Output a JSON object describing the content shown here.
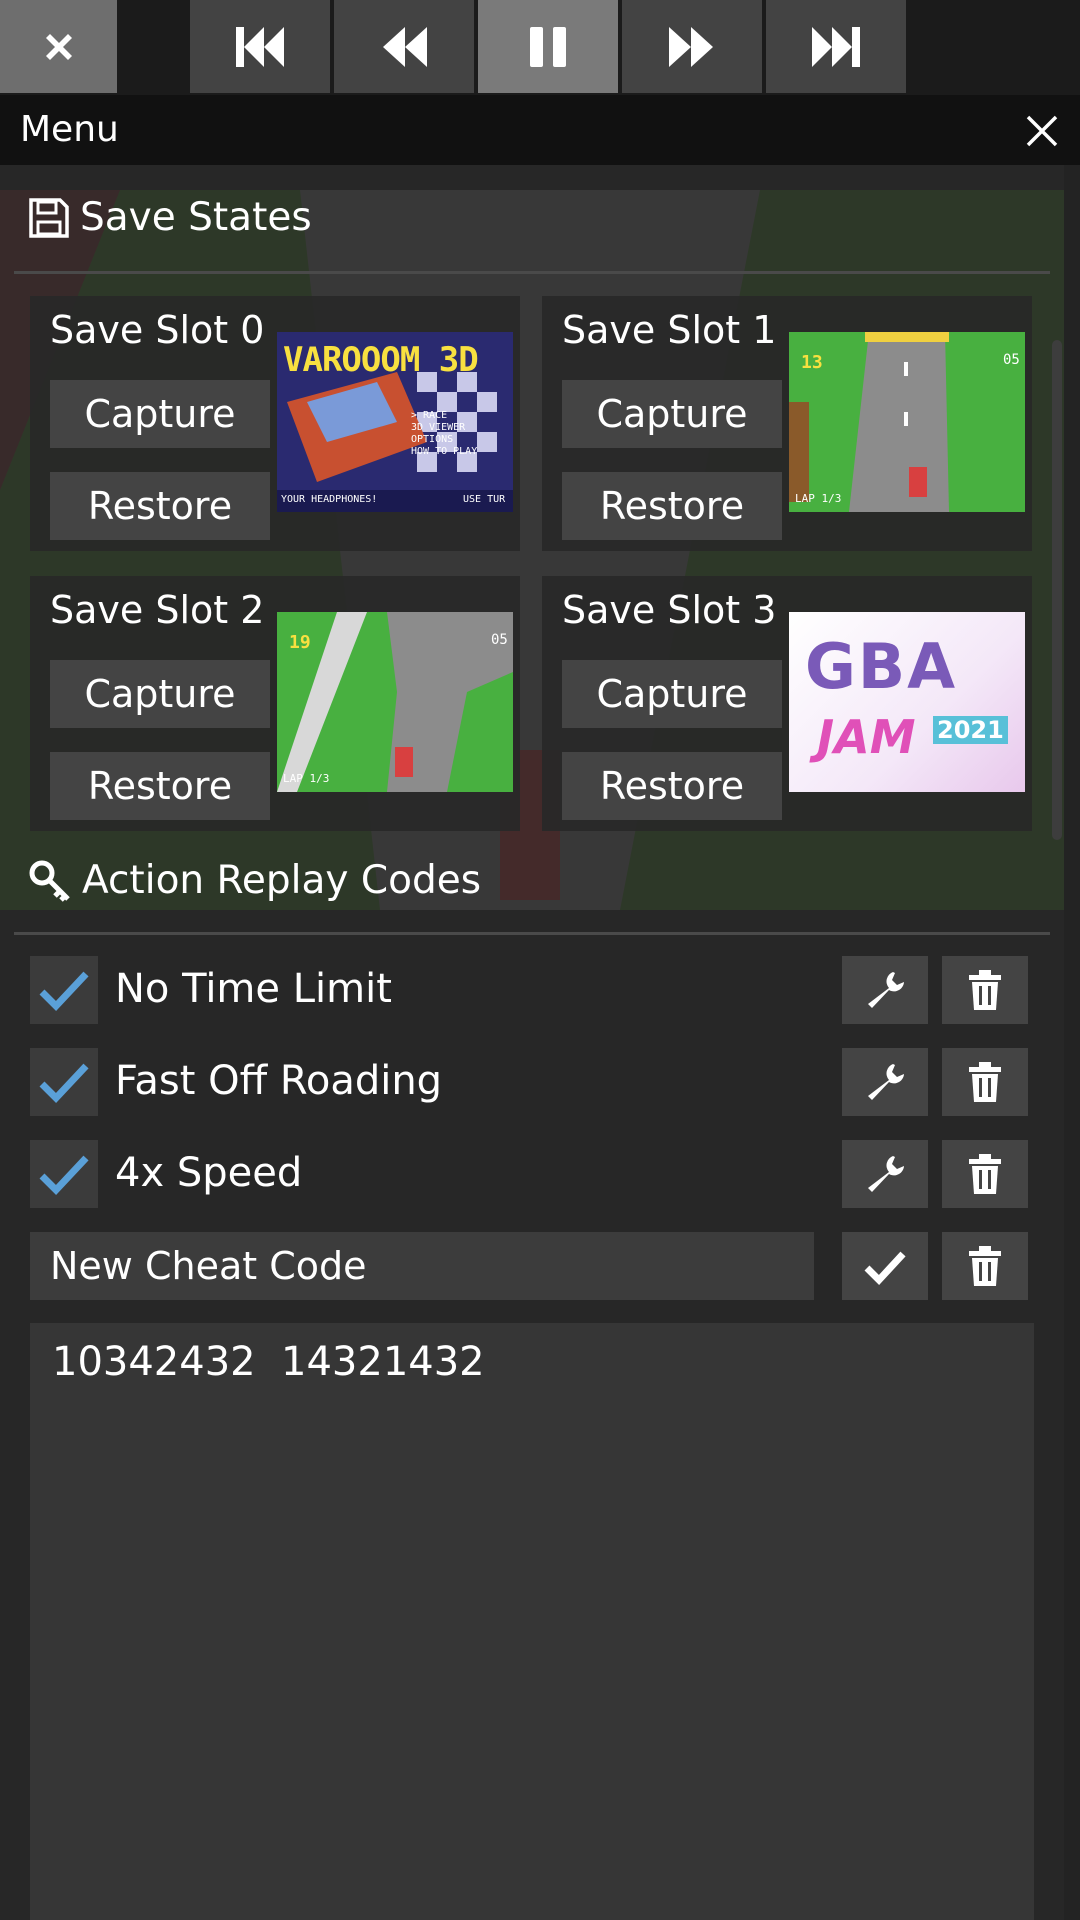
{
  "toolbar": {
    "buttons": [
      {
        "name": "close",
        "icon": "close-icon"
      },
      {
        "name": "skip-back",
        "icon": "skip-back-icon"
      },
      {
        "name": "rewind",
        "icon": "rewind-icon"
      },
      {
        "name": "pause",
        "icon": "pause-icon"
      },
      {
        "name": "fast-forward",
        "icon": "fast-forward-icon"
      },
      {
        "name": "skip-forward",
        "icon": "skip-forward-icon"
      }
    ]
  },
  "menu": {
    "title": "Menu",
    "close_icon": "close-icon"
  },
  "save_states": {
    "title": "Save States",
    "icon": "floppy-disk-icon",
    "slots": [
      {
        "label": "Save Slot 0",
        "capture": "Capture",
        "restore": "Restore",
        "thumb_text": "VAROOOM 3D",
        "thumb_menu": [
          "> RACE",
          "3D VIEWER",
          "OPTIONS",
          "HOW TO PLAY"
        ],
        "thumb_footer_left": "YOUR HEADPHONES!",
        "thumb_footer_right": "USE TUR"
      },
      {
        "label": "Save Slot 1",
        "capture": "Capture",
        "restore": "Restore",
        "thumb_time": "13",
        "thumb_pos": "05",
        "thumb_lap": "LAP 1/3"
      },
      {
        "label": "Save Slot 2",
        "capture": "Capture",
        "restore": "Restore",
        "thumb_time": "19",
        "thumb_pos": "05",
        "thumb_lap": "LAP 1/3"
      },
      {
        "label": "Save Slot 3",
        "capture": "Capture",
        "restore": "Restore",
        "thumb_line1": "GBA",
        "thumb_line2": "JAM",
        "thumb_year": "2021"
      }
    ]
  },
  "cheats": {
    "title": "Action Replay Codes",
    "icon": "key-icon",
    "items": [
      {
        "name": "No Time Limit",
        "checked": true
      },
      {
        "name": "Fast Off Roading",
        "checked": true
      },
      {
        "name": "4x Speed",
        "checked": true
      }
    ],
    "new_cheat_value": "New Cheat Code",
    "code_text": "10342432  14321432"
  },
  "colors": {
    "accent_check": "#5aa0d8",
    "button_bg": "#444444",
    "header_bg": "#111111"
  }
}
